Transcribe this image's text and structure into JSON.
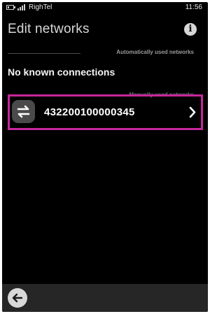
{
  "status_bar": {
    "operator": "RighTel",
    "time": "11:56",
    "battery_icon": "battery-icon",
    "signal_icon": "signal-icon"
  },
  "header": {
    "title": "Edit networks",
    "info_icon": "info-icon",
    "info_glyph": "i"
  },
  "sections": {
    "automatic_label": "Automatically used networks",
    "empty_message": "No known connections",
    "manual_label": "Manually used networks"
  },
  "networks": [
    {
      "name": "432200100000345",
      "icon": "swap-arrows-icon",
      "action_icon": "chevron-right-icon"
    }
  ],
  "toolbar": {
    "back_icon": "back-arrow-icon"
  },
  "colors": {
    "background": "#000000",
    "highlight": "#c7279c",
    "toolbar": "#262626"
  }
}
